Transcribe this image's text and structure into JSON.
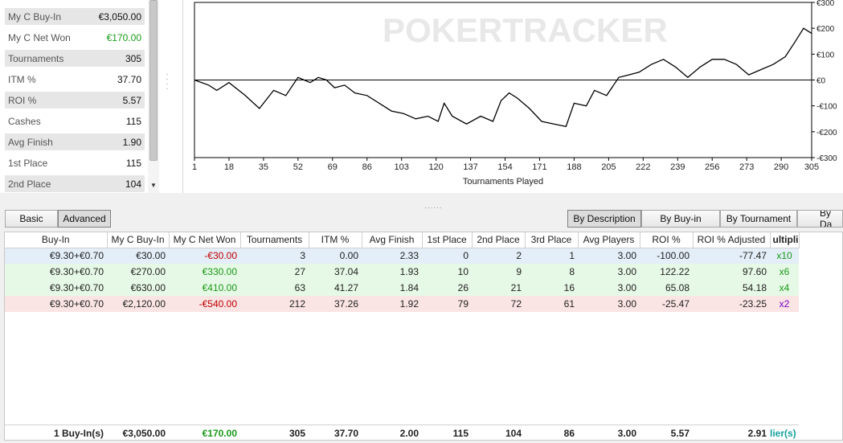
{
  "stats": [
    {
      "label": "My C Buy-In",
      "value": "€3,050.00",
      "green": false
    },
    {
      "label": "My C Net Won",
      "value": "€170.00",
      "green": true
    },
    {
      "label": "Tournaments",
      "value": "305",
      "green": false
    },
    {
      "label": "ITM %",
      "value": "37.70",
      "green": false
    },
    {
      "label": "ROI %",
      "value": "5.57",
      "green": false
    },
    {
      "label": "Cashes",
      "value": "115",
      "green": false
    },
    {
      "label": "Avg Finish",
      "value": "1.90",
      "green": false
    },
    {
      "label": "1st Place",
      "value": "115",
      "green": false
    },
    {
      "label": "2nd Place",
      "value": "104",
      "green": false
    }
  ],
  "graph": {
    "watermark": "POKERTRACKER",
    "xlabel": "Tournaments Played",
    "x_ticks": [
      "1",
      "18",
      "35",
      "52",
      "69",
      "86",
      "103",
      "120",
      "137",
      "154",
      "171",
      "188",
      "205",
      "222",
      "239",
      "256",
      "273",
      "290",
      "305"
    ],
    "y_ticks": [
      "€300",
      "€200",
      "€100",
      "€0",
      "-€100",
      "-€200",
      "-€300"
    ],
    "y_values": [
      300,
      200,
      100,
      0,
      -100,
      -200,
      -300
    ],
    "line_color": "#000000"
  },
  "chart_data": {
    "type": "line",
    "xlabel": "Tournaments Played",
    "ylabel": "",
    "xlim": [
      1,
      305
    ],
    "ylim": [
      -300,
      300
    ],
    "x": [
      1,
      8,
      12,
      18,
      26,
      33,
      40,
      46,
      52,
      58,
      62,
      66,
      70,
      75,
      80,
      86,
      92,
      98,
      104,
      110,
      116,
      121,
      124,
      128,
      135,
      142,
      148,
      152,
      156,
      160,
      166,
      172,
      178,
      184,
      188,
      194,
      198,
      204,
      210,
      215,
      220,
      226,
      232,
      238,
      244,
      250,
      256,
      262,
      268,
      274,
      280,
      286,
      292,
      297,
      301,
      305
    ],
    "y": [
      0,
      -20,
      -40,
      -10,
      -60,
      -110,
      -40,
      -60,
      10,
      -10,
      10,
      0,
      -30,
      -20,
      -50,
      -60,
      -90,
      -120,
      -130,
      -150,
      -140,
      -160,
      -90,
      -140,
      -170,
      -140,
      -160,
      -80,
      -50,
      -70,
      -110,
      -160,
      -170,
      -180,
      -90,
      -100,
      -40,
      -60,
      10,
      20,
      30,
      60,
      80,
      50,
      10,
      50,
      80,
      80,
      60,
      20,
      40,
      60,
      90,
      150,
      200,
      180
    ],
    "title": ""
  },
  "view_buttons": {
    "basic": "Basic",
    "advanced": "Advanced"
  },
  "group_buttons": {
    "by_description": "By Description",
    "by_buyin": "By Buy-in",
    "by_tournament": "By Tournament",
    "by_date": "By Da"
  },
  "table": {
    "headers": [
      "Buy-In",
      "My C Buy-In",
      "My C Net Won",
      "Tournaments",
      "ITM %",
      "Avg Finish",
      "1st Place",
      "2nd Place",
      "3rd Place",
      "Avg Players",
      "ROI %",
      "ROI % Adjusted",
      "ultipli"
    ],
    "rows": [
      {
        "bg": "#e3eef8",
        "cells": [
          "€9.30+€0.70",
          "€30.00",
          "-€30.00",
          "3",
          "0.00",
          "2.33",
          "0",
          "2",
          "1",
          "3.00",
          "-100.00",
          "-77.47",
          "x10"
        ],
        "net": "neg",
        "mult": "mult-green"
      },
      {
        "bg": "#e6f8e6",
        "cells": [
          "€9.30+€0.70",
          "€270.00",
          "€330.00",
          "27",
          "37.04",
          "1.93",
          "10",
          "9",
          "8",
          "3.00",
          "122.22",
          "97.60",
          "x6"
        ],
        "net": "pos",
        "mult": "mult-green"
      },
      {
        "bg": "#e6f8e6",
        "cells": [
          "€9.30+€0.70",
          "€630.00",
          "€410.00",
          "63",
          "41.27",
          "1.84",
          "26",
          "21",
          "16",
          "3.00",
          "65.08",
          "54.18",
          "x4"
        ],
        "net": "pos",
        "mult": "mult-green"
      },
      {
        "bg": "#fae4e4",
        "cells": [
          "€9.30+€0.70",
          "€2,120.00",
          "-€540.00",
          "212",
          "37.26",
          "1.92",
          "79",
          "72",
          "61",
          "3.00",
          "-25.47",
          "-23.25",
          "x2"
        ],
        "net": "neg",
        "mult": "mult-purple"
      }
    ],
    "totals": [
      "1 Buy-In(s)",
      "€3,050.00",
      "€170.00",
      "305",
      "37.70",
      "2.00",
      "115",
      "104",
      "86",
      "3.00",
      "5.57",
      "2.91",
      "lier(s)"
    ]
  }
}
